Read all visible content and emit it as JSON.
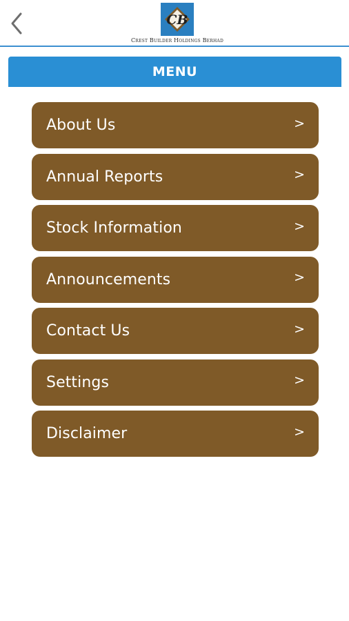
{
  "header": {
    "back_icon": "chevron-left-icon",
    "company_name": "Crest Builder Holdings Berhad",
    "logo_initials": "CB",
    "colors": {
      "accent_line": "#3b8fd0",
      "logo_blue": "#2a7fc0",
      "logo_brown": "#7f5a28"
    }
  },
  "menu": {
    "title": "MENU",
    "bar_color": "#2a8fd4",
    "item_color": "#7f5a28",
    "arrow_glyph": ">",
    "items": [
      {
        "label": "About Us"
      },
      {
        "label": "Annual Reports"
      },
      {
        "label": "Stock Information"
      },
      {
        "label": "Announcements"
      },
      {
        "label": "Contact Us"
      },
      {
        "label": "Settings"
      },
      {
        "label": "Disclaimer"
      }
    ]
  }
}
